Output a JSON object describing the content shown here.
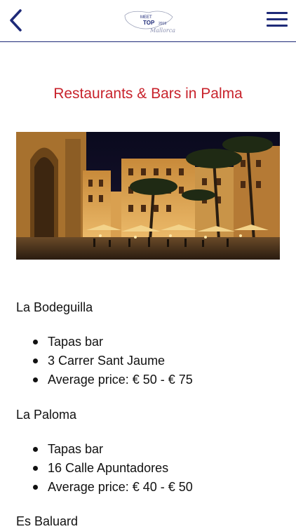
{
  "header": {
    "logo": {
      "line1": "MEET",
      "line2": "TOP",
      "year": "2019",
      "script": "Mallorca"
    }
  },
  "page_title": "Restaurants & Bars in Palma",
  "photo": {
    "icon": "palma-plaza-night-photo"
  },
  "restaurants": [
    {
      "name": "La Bodeguilla",
      "details": [
        "Tapas bar",
        "3 Carrer Sant Jaume",
        "Average price: € 50 - € 75"
      ]
    },
    {
      "name": "La Paloma",
      "details": [
        "Tapas bar",
        "16 Calle Apuntadores",
        "Average price: € 40 - € 50"
      ]
    },
    {
      "name": "Es Baluard",
      "details": []
    }
  ]
}
